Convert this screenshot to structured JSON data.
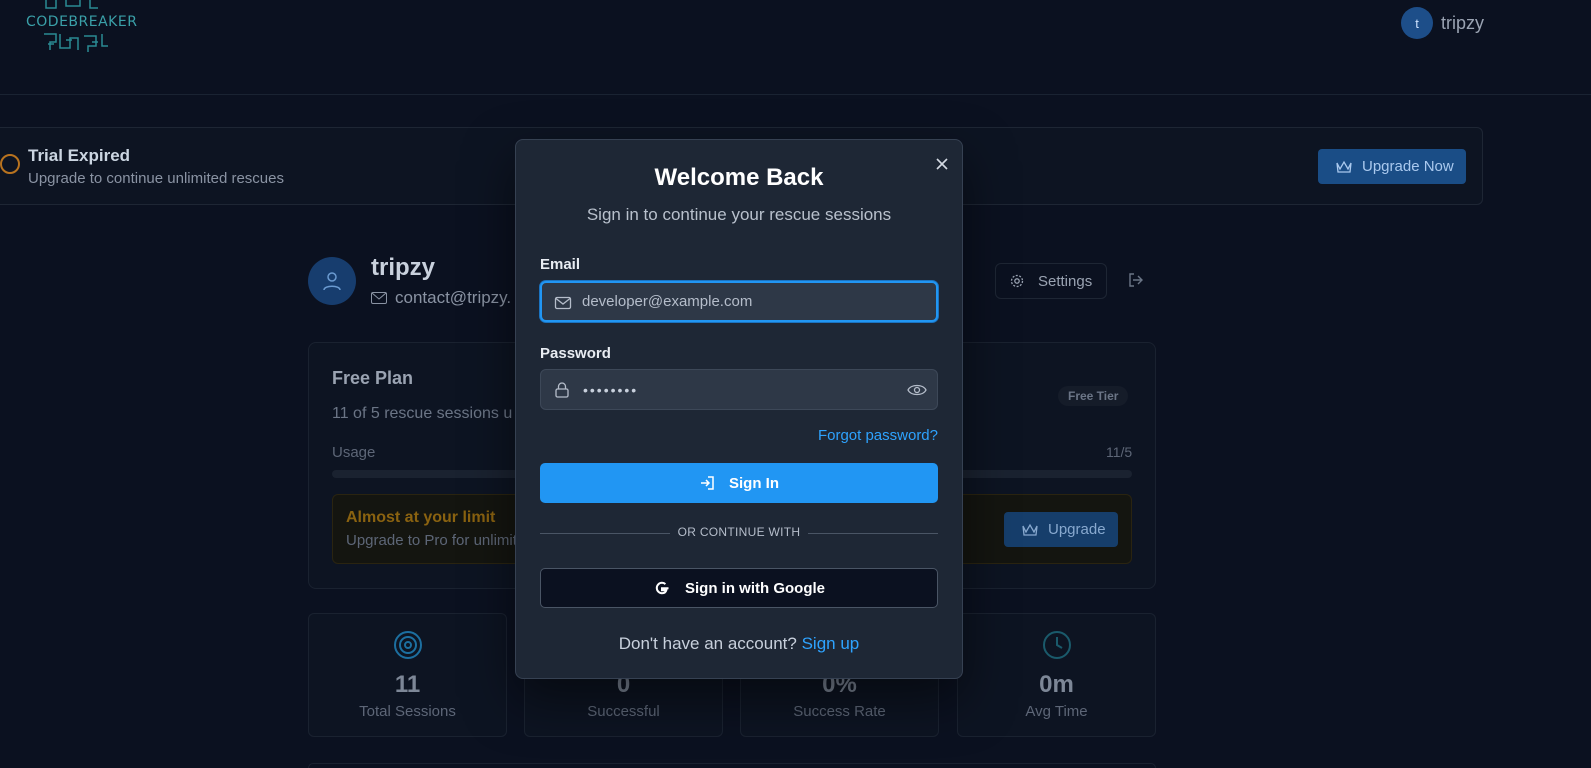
{
  "app": {
    "logo_text": "CODEBREAKER"
  },
  "header": {
    "user_initial": "t",
    "username": "tripzy"
  },
  "trial": {
    "title": "Trial Expired",
    "subtitle": "Upgrade to continue unlimited rescues",
    "button": "Upgrade Now"
  },
  "profile": {
    "name": "tripzy",
    "email": "contact@tripzy.",
    "settings_label": "Settings"
  },
  "plan": {
    "title": "Free Plan",
    "subtitle": "11 of 5 rescue sessions u",
    "badge": "Free Tier",
    "usage_label": "Usage",
    "usage_count": "11/5",
    "usage_fraction": 1.0,
    "limit_title": "Almost at your limit",
    "limit_sub": "Upgrade to Pro for unlimit",
    "upgrade_label": "Upgrade"
  },
  "stats": [
    {
      "value": "11",
      "label": "Total Sessions",
      "icon": "target-icon"
    },
    {
      "value": "0",
      "label": "Successful",
      "icon": "check-icon"
    },
    {
      "value": "0%",
      "label": "Success Rate",
      "icon": "trend-icon"
    },
    {
      "value": "0m",
      "label": "Avg Time",
      "icon": "clock-icon"
    }
  ],
  "modal": {
    "title": "Welcome Back",
    "subtitle": "Sign in to continue your rescue sessions",
    "email_label": "Email",
    "email_placeholder": "developer@example.com",
    "password_label": "Password",
    "password_value": "••••••••",
    "forgot": "Forgot password?",
    "signin": "Sign In",
    "divider": "OR CONTINUE WITH",
    "google": "Sign in with Google",
    "signup_prompt": "Don't have an account?",
    "signup_link": "Sign up"
  },
  "colors": {
    "background": "#0b1120",
    "modal_bg": "#1e2735",
    "accent": "#2196f3",
    "link": "#2ea3ff"
  }
}
